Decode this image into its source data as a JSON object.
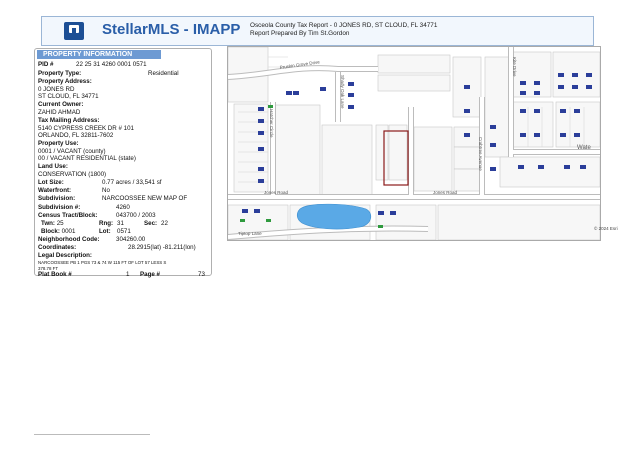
{
  "header": {
    "brand": "StellarMLS - IMAPP",
    "line1": "Osceola County Tax Report - 0 JONES RD, ST CLOUD, FL 34771",
    "line2": "Report Prepared By Tim St.Gordon"
  },
  "panel": {
    "title": "PROPERTY INFORMATION",
    "pid_label": "PID #",
    "pid": "22 25 31 4260 0001 0571",
    "property_type_label": "Property Type:",
    "property_type": "Residential",
    "address_label": "Property Address:",
    "address1": "0 JONES RD",
    "address2": "ST CLOUD, FL 34771",
    "owner_label": "Current Owner:",
    "owner": "ZAHID AHMAD",
    "mailing_label": "Tax Mailing Address:",
    "mailing1": "5140 CYPRESS CREEK DR # 101",
    "mailing2": "ORLANDO, FL 32811-7602",
    "use_label": "Property Use:",
    "use1": "0001 / VACANT (county)",
    "use2": "00 / VACANT RESIDENTIAL (state)",
    "land_use_label": "Land Use:",
    "land_use": "CONSERVATION (1800)",
    "lot_size_label": "Lot Size:",
    "lot_size": "0.77 acres / 33,541 sf",
    "waterfront_label": "Waterfront:",
    "waterfront": "No",
    "subdivision_label": "Subdivision:",
    "subdivision": "NARCOOSSEE NEW MAP OF",
    "subdivision_num_label": "Subdivision #:",
    "subdivision_num": "4260",
    "census_label": "Census Tract/Block:",
    "census": "043700 / 2003",
    "twn_label": "Twn:",
    "twn": "25",
    "rng_label": "Rng:",
    "rng": "31",
    "sec_label": "Sec:",
    "sec": "22",
    "block_label": "Block:",
    "block": "0001",
    "lot_label": "Lot:",
    "lot": "0571",
    "neighborhood_label": "Neighborhood Code:",
    "neighborhood": "304260.00",
    "coords_label": "Coordinates:",
    "coords": "28.2915(lat) -81.211(lon)",
    "legal_label": "Legal Description:",
    "legal1": "NARCOOSSEE PB 1 PGS 73 & 74 W 115 FT OF LOT 57 LESS S",
    "legal2": "378.78 FT",
    "plat_book_label": "Plat Book #",
    "plat_book": "1",
    "page_label": "Page #",
    "page": "73"
  },
  "map": {
    "roads": [
      "Pruskin Grove Drive",
      "Shady Oak Lane",
      "Jones Road",
      "Jones Road",
      "Tiptop Lane",
      "Hatcher Circle",
      "Crabtree Avenue",
      "Kite Drive"
    ],
    "water_label": "Wate",
    "copyright": "© 2024 Esri"
  }
}
